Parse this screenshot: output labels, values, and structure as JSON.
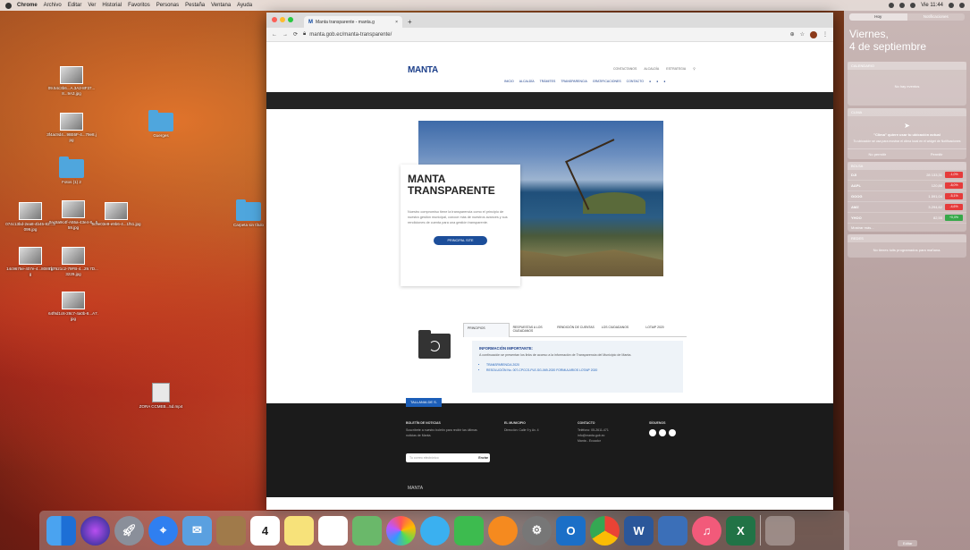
{
  "menubar": {
    "app": "Chrome",
    "items": [
      "Archivo",
      "Editar",
      "Ver",
      "Historial",
      "Favoritos",
      "Personas",
      "Pestaña",
      "Ventana",
      "Ayuda"
    ],
    "clock": "Vie 11:44"
  },
  "desktop": {
    "icons": [
      {
        "label": "09.54c3b6...A.3A2-8F37...8...9A3.jpg",
        "kind": "image"
      },
      {
        "label": "3f4ac9d4...98E6F-4...79e8.jpg",
        "kind": "image"
      },
      {
        "label": "Fotos (1) 2",
        "kind": "folder"
      },
      {
        "label": "Guerges",
        "kind": "folder"
      },
      {
        "label": "Carpeta sin título",
        "kind": "folder"
      },
      {
        "label": "074c13bd-2ea8-4b45-83...3099.jpg",
        "kind": "image"
      },
      {
        "label": "0ac8a9c4f-A55a-43e4-8...559.jpg",
        "kind": "image"
      },
      {
        "label": "5c9e03e9-e9b6-4...1f51.jpg",
        "kind": "image"
      },
      {
        "label": "14c9675e-407e-4...8089.jpg",
        "kind": "image"
      },
      {
        "label": "7b7621c2-79FB-4...29.7D...3229.jpg",
        "kind": "image"
      },
      {
        "label": "64f9d1c6-28c7-4a0b-8...A7.jpg",
        "kind": "image"
      },
      {
        "label": "ZORA CCMEB...5d.mp4",
        "kind": "video"
      }
    ]
  },
  "browser": {
    "tab_title": "Manta transparente - manta.g",
    "tab_favicon": "M",
    "url": "manta.gob.ec/manta-transparente/",
    "site": {
      "logo": "MANTA",
      "util_links": [
        "CONTACTANOS",
        "ALCALDÍA",
        "ESTRATEGIA"
      ],
      "nav": [
        "INICIO",
        "ALCALDÍA",
        "TRÁMITES",
        "TRANSPARENCIA",
        "GRATIFICACIONES",
        "CONTACTO"
      ],
      "hero_title": "MANTA TRANSPARENTE",
      "hero_text": "Nuestro compromiso tiene la transparencia como el principio de nuestra gestión municipal, conoce más de nuestros avances y sus rendiciones de cuenta para una gestión transparente.",
      "hero_cta": "PRINCIPAL SITE",
      "tabs": [
        "PRINCIPIOS",
        "RESPUESTAS A LOS CIUDADANOS",
        "RENDICIÓN DE CUENTAS",
        "LOS CIUDADANOS",
        "LOTAIP 2020"
      ],
      "info_title": "INFORMACIÓN IMPORTANTE:",
      "info_text": "A continuación se presentan los links de acceso a la información de Transparencia del Municipio de Manta.",
      "info_links": [
        "TRANSPARENCIA 2020",
        "RESOLUCIÓN No. 007-CPCCS-PLE-SG-069-2020 FORMULARIOS LOTAIP 2020"
      ],
      "footer_lang": "TALLANIA DE S.",
      "footer_cols": [
        {
          "title": "BOLETÍN DE NOTICIAS",
          "lines": [
            "Suscríbete a nuestro boletín para recibir las últimas noticias de Manta."
          ]
        },
        {
          "title": "EL MUNICIPIO",
          "lines": [
            "Dirección: Calle 9 y Av. 4"
          ]
        },
        {
          "title": "CONTACTO",
          "lines": [
            "Teléfono: 05-2611-471",
            "info@manta.gob.ec",
            "Manta - Ecuador"
          ]
        },
        {
          "title": "SÍGUENOS",
          "lines": []
        }
      ],
      "subscribe_placeholder": "Tu correo electrónico",
      "subscribe_button": "Enviar",
      "footer_logo": "MANTA"
    }
  },
  "notification_center": {
    "tabs": [
      "Hoy",
      "Notificaciones"
    ],
    "day": "Viernes,",
    "date": "4 de septiembre",
    "calendar_header": "CALENDARIO",
    "calendar_body": "No hay eventos",
    "weather_header": "CLIMA",
    "weather_title": "\"Clima\" quiere usar tu ubicación actual",
    "weather_text": "Tu ubicación se usa para mostrar el clima local en el widget de Notificaciones",
    "weather_btns": [
      "No permitir",
      "Permitir"
    ],
    "stocks_header": "BOLSA",
    "stocks": [
      {
        "sym": "DJI",
        "price": "28 133,31",
        "change": "-1,0%",
        "dir": "neg"
      },
      {
        "sym": "AAPL",
        "price": "120,88",
        "change": "-8,0%",
        "dir": "neg"
      },
      {
        "sym": "GOOG",
        "price": "1.591,04",
        "change": "-5,1%",
        "dir": "neg"
      },
      {
        "sym": "AMZ",
        "price": "3.294,62",
        "change": "-4,6%",
        "dir": "neg"
      },
      {
        "sym": "YHOO",
        "price": "82,55",
        "change": "+0,0%",
        "dir": "pos"
      }
    ],
    "stocks_more": "Mostrar más...",
    "social_header": "REDES",
    "social_body": "No tienes tuits programados para mañana.",
    "footer_btn": "Editar"
  },
  "dock": {
    "items": [
      "finder-icon",
      "siri-icon",
      "launchpad-icon",
      "safari-icon",
      "mail-icon",
      "contacts-icon",
      "calendar-icon",
      "notes-icon",
      "reminders-icon",
      "maps-icon",
      "photos-icon",
      "messages-icon",
      "facetime-icon",
      "books-icon",
      "system-prefs-icon",
      "outlook-icon",
      "chrome-icon",
      "word-icon",
      "keynote-icon",
      "music-icon",
      "excel-icon",
      "trash-icon"
    ],
    "calendar_day": "4"
  }
}
